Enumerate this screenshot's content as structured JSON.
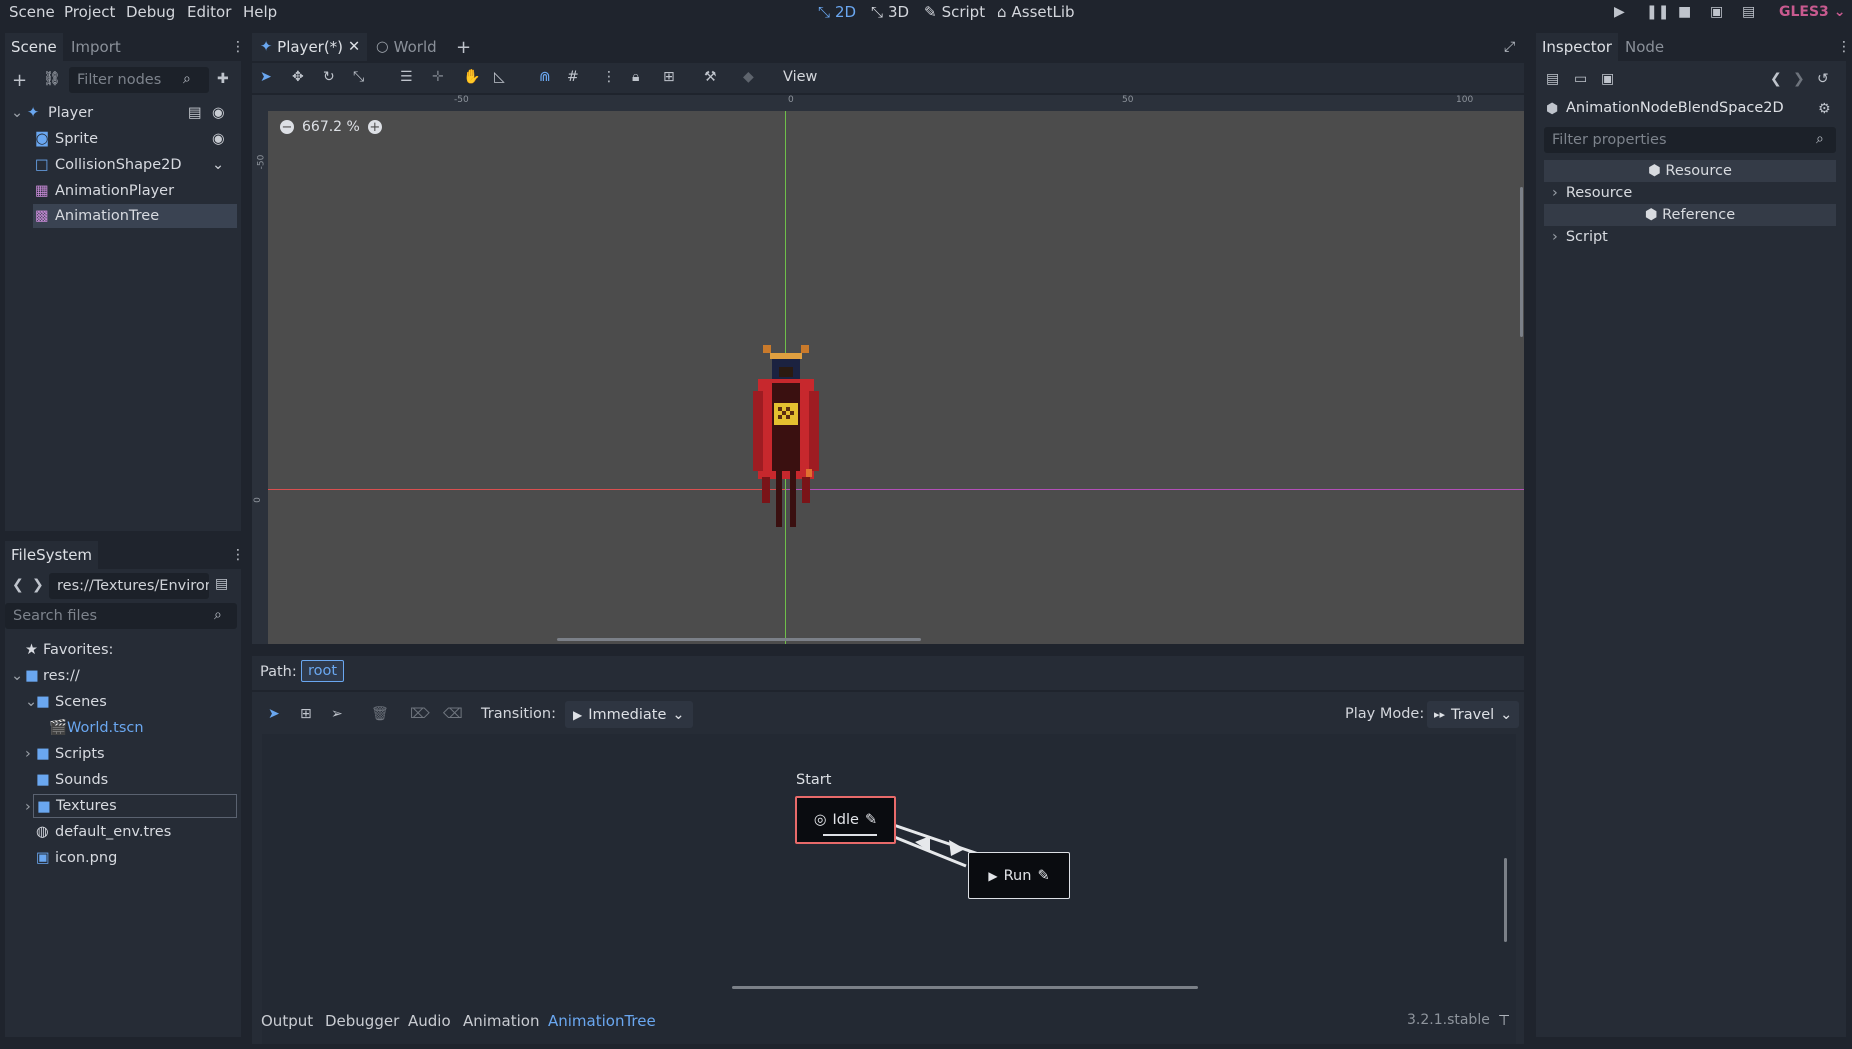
{
  "menu": {
    "items": [
      "Scene",
      "Project",
      "Debug",
      "Editor",
      "Help"
    ]
  },
  "modes": {
    "items": [
      "2D",
      "3D",
      "Script",
      "AssetLib"
    ],
    "active": "2D"
  },
  "renderer": "GLES3",
  "scene_dock": {
    "tabs": [
      "Scene",
      "Import"
    ],
    "filter_placeholder": "Filter nodes",
    "tree": [
      {
        "label": "Player",
        "icon": "kinematic-body-icon"
      },
      {
        "label": "Sprite",
        "icon": "sprite-icon"
      },
      {
        "label": "CollisionShape2D",
        "icon": "collision-shape-icon"
      },
      {
        "label": "AnimationPlayer",
        "icon": "animation-player-icon"
      },
      {
        "label": "AnimationTree",
        "icon": "animation-tree-icon"
      }
    ]
  },
  "filesystem": {
    "tab": "FileSystem",
    "path": "res://Textures/Environ",
    "search_placeholder": "Search files",
    "items": [
      {
        "label": "Favorites:"
      },
      {
        "label": "res://"
      },
      {
        "label": "Scenes"
      },
      {
        "label": "World.tscn"
      },
      {
        "label": "Scripts"
      },
      {
        "label": "Sounds"
      },
      {
        "label": "Textures"
      },
      {
        "label": "default_env.tres"
      },
      {
        "label": "icon.png"
      }
    ]
  },
  "editor_tabs": {
    "items": [
      "Player(*)",
      "World"
    ]
  },
  "toolbar": {
    "view_label": "View"
  },
  "viewport": {
    "zoom": "667.2 %",
    "ruler_labels": [
      "-50",
      "0",
      "50",
      "100"
    ],
    "vruler_labels": [
      "-50",
      "0"
    ]
  },
  "anim_tree": {
    "path_label": "Path:",
    "path_value": "root",
    "transition_label": "Transition:",
    "transition_value": "Immediate",
    "play_mode_label": "Play Mode:",
    "play_mode_value": "Travel",
    "start_label": "Start",
    "nodes": [
      {
        "label": "Idle"
      },
      {
        "label": "Run"
      }
    ]
  },
  "bottom_tabs": {
    "items": [
      "Output",
      "Debugger",
      "Audio",
      "Animation",
      "AnimationTree"
    ],
    "active": "AnimationTree"
  },
  "version": "3.2.1.stable",
  "inspector": {
    "tabs": [
      "Inspector",
      "Node"
    ],
    "resource_name": "AnimationNodeBlendSpace2D",
    "filter_placeholder": "Filter properties",
    "sections": [
      "Resource",
      "Resource",
      "Reference",
      "Script"
    ]
  },
  "colors": {
    "accent": "#6aa7f0",
    "renderer": "#c85a8f",
    "axis_x": "#d94f4f",
    "axis_y": "#6fbf4a"
  }
}
